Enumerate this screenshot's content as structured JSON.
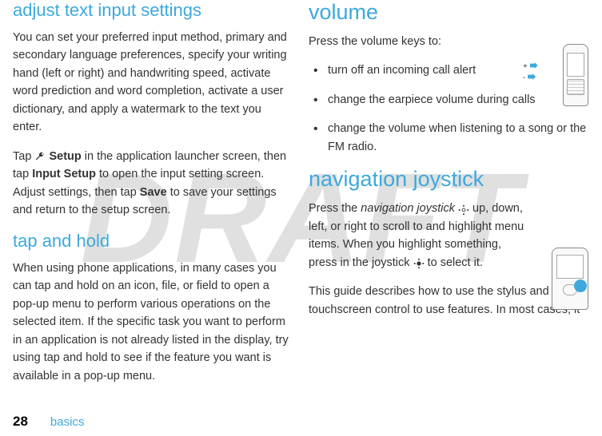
{
  "watermark": "DRAFT",
  "left": {
    "heading1": "adjust text input settings",
    "para1": "You can set your preferred input method, primary and secondary language preferences, specify your writing hand (left or right) and handwriting speed, activate word prediction and word completion, activate a user dictionary, and apply a watermark to the text you enter.",
    "para2_prefix": "Tap ",
    "setup_label": "Setup",
    "para2_mid": " in the application launcher screen, then tap ",
    "input_setup_label": "Input Setup",
    "para2_mid2": " to open the input setting screen. Adjust settings, then tap ",
    "save_label": "Save",
    "para2_end": " to save your settings and return to the setup screen.",
    "heading2": "tap and hold",
    "para3": "When using phone applications, in many cases you can tap and hold on an icon, file, or field to open a pop-up menu to perform various operations on the selected item. If the specific task you want to perform in an application is not already listed in the display, try using tap and hold to see if the feature you want is available in a pop-up menu."
  },
  "right": {
    "heading1": "volume",
    "intro1": "Press the volume keys to:",
    "bullets": [
      "turn off an incoming call alert",
      "change the earpiece volume during calls",
      "change the volume when listening to a song or the FM radio."
    ],
    "heading2": "navigation joystick",
    "para_nav_prefix": "Press the ",
    "nav_joystick_term": "navigation joystick",
    "para_nav_mid": " up, down, left, or right to scroll to and highlight menu items. When you highlight something, press in the joystick ",
    "para_nav_end": " to select it.",
    "para_guide": "This guide describes how to use the stylus and touchscreen control to use features. In most cases, it"
  },
  "footer": {
    "page": "28",
    "section": "basics"
  },
  "phone_labels": {
    "plus": "+",
    "minus": "-"
  }
}
